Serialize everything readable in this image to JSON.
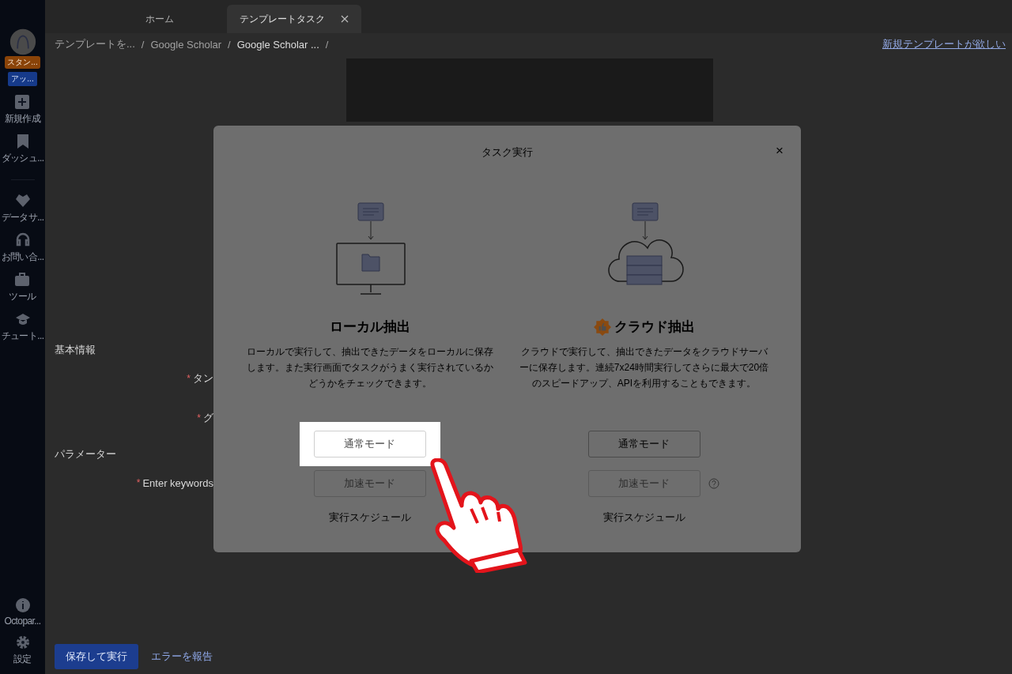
{
  "sidebar": {
    "avatar_badge": "スタン...",
    "upgrade_button": "アッ...",
    "items": [
      {
        "kind": "plus",
        "label": "新規作成"
      },
      {
        "kind": "bookmark",
        "label": "ダッシュ..."
      },
      {
        "kind": "divider"
      },
      {
        "kind": "heart",
        "label": "データサ..."
      },
      {
        "kind": "headset",
        "label": "お問い合..."
      },
      {
        "kind": "toolbox",
        "label": "ツール"
      },
      {
        "kind": "cap",
        "label": "チュート..."
      }
    ],
    "bottom_items": [
      {
        "kind": "info",
        "label": "Octopar..."
      },
      {
        "kind": "gear",
        "label": "設定"
      }
    ]
  },
  "tabs": [
    {
      "label": "ホーム",
      "selected": false,
      "closable": false
    },
    {
      "label": "テンプレートタスク",
      "selected": true,
      "closable": true
    }
  ],
  "breadcrumb": [
    {
      "label": "テンプレートを...",
      "current": false,
      "separator": "/"
    },
    {
      "label": "Google Scholar",
      "current": false,
      "separator": "/"
    },
    {
      "label": "Google Scholar ...",
      "current": true,
      "separator": "/"
    }
  ],
  "new_template_link": "新規テンプレートが欲しい",
  "form": {
    "sections": [
      {
        "title": "基本情報",
        "fields": [
          {
            "label": "タン",
            "required_mark": "*"
          },
          {
            "label": "グ",
            "required_mark": "*"
          }
        ]
      },
      {
        "title": "パラメーター",
        "fields": [
          {
            "label": "Enter keywords",
            "required_mark": "*"
          }
        ]
      }
    ]
  },
  "footer": {
    "primary_button": "保存して実行",
    "link": "エラーを報告"
  },
  "dialog": {
    "title": "タスク実行",
    "close": "×",
    "options": [
      {
        "kind": "local",
        "title": "ローカル抽出",
        "premium": false,
        "description": "ローカルで実行して、抽出できたデータをローカルに保存します。また実行画面でタスクがうまく実行されているかどうかをチェックできます。",
        "buttons": [
          {
            "label": "通常モード",
            "disabled": false,
            "highlighted": true,
            "help": false
          },
          {
            "label": "加速モード",
            "disabled": true,
            "highlighted": false,
            "help": false
          }
        ],
        "schedule": "実行スケジュール"
      },
      {
        "kind": "cloud",
        "title": "クラウド抽出",
        "premium": true,
        "description": "クラウドで実行して、抽出できたデータをクラウドサーバーに保存します。連続7x24時間実行してさらに最大で20倍のスピードアップ、APIを利用することもできます。",
        "buttons": [
          {
            "label": "通常モード",
            "disabled": false,
            "highlighted": false,
            "help": false
          },
          {
            "label": "加速モード",
            "disabled": true,
            "highlighted": false,
            "help": true
          }
        ],
        "schedule": "実行スケジュール"
      }
    ]
  }
}
